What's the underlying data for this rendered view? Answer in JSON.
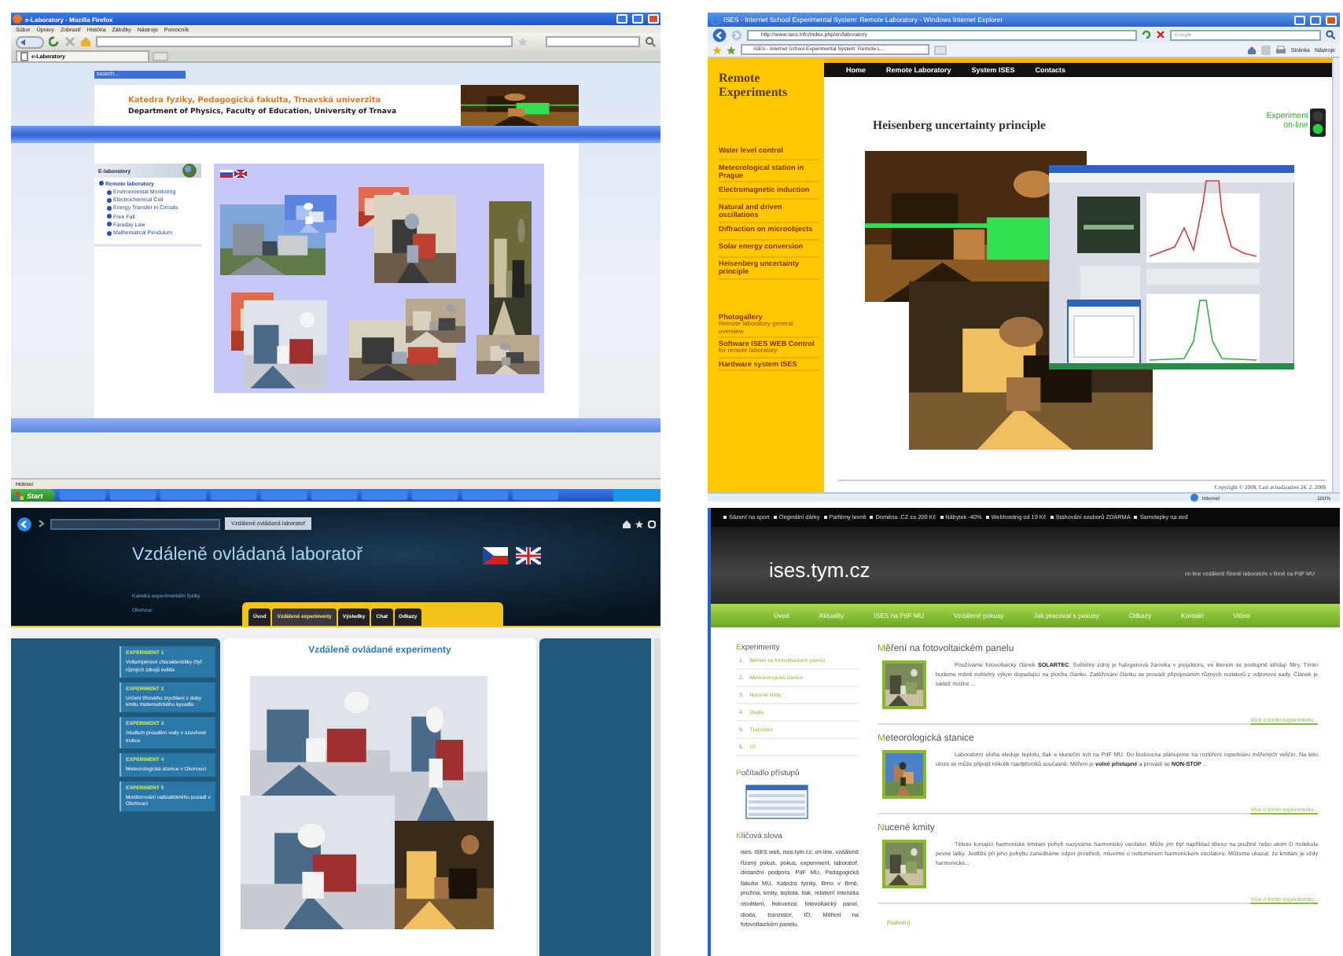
{
  "firefox_window": {
    "title": "e-Laboratory - Mozilla Firefox",
    "menu": [
      "Súbor",
      "Úpravy",
      "Zobraziť",
      "História",
      "Záložky",
      "Nástroje",
      "Pomocník"
    ],
    "tab": "e-Laboratory",
    "search": {
      "placeholder": "search..."
    },
    "header": {
      "title": "Katedra fyziky, Pedagogická fakulta, Trnavská univerzita",
      "subtitle": "Department of Physics, Faculty of Education, University of Trnava"
    },
    "sidebar": {
      "title": "E-laboratory",
      "items": [
        {
          "label": "Remote laboratory",
          "children": [
            {
              "label": "Environmental Monitoring"
            },
            {
              "label": "Electrochemical Cell"
            },
            {
              "label": "Energy Transfer in Circuits"
            },
            {
              "label": "Free Fall"
            },
            {
              "label": "Faraday Law"
            },
            {
              "label": "Mathematical Pendulum"
            }
          ]
        }
      ]
    },
    "status_bar": "Hotovo",
    "taskbar": {
      "start": "Start"
    }
  },
  "ie_window": {
    "title": "ISES - Internet School Experimental System: Remote Laboratory - Windows Internet Explorer",
    "address": "http://www.ises.info/index.php/en/laboratory",
    "tab": "ISES - Internet School Experimental System: Remote L...",
    "search": {
      "placeholder": "Google"
    },
    "toolbar": [
      "Stránka",
      "Nástroje"
    ],
    "nav": [
      "Home",
      "Remote Laboratory",
      "System ISES",
      "Contacts"
    ],
    "sidebar": {
      "title": "Remote Experiments",
      "experiments": [
        "Water level control",
        "Meteorological station in Prague",
        "Electromagnetic induction",
        "Natural and driven oscillations",
        "Diffraction on microobjects",
        "Solar energy conversion",
        "Heisenberg uncertainty principle"
      ],
      "links": [
        {
          "title": "Photogallery",
          "subtitle": "Remote laboratory general overview"
        },
        {
          "title": "Software ISES WEB Control",
          "subtitle": "for remote laboratory"
        },
        {
          "title": "Hardware system ISES"
        }
      ]
    },
    "heading": "Heisenberg uncertainty principle",
    "experiment_status": {
      "label": "Experiment on-line",
      "online": true
    },
    "copyright": "Copyright © 2008, Last actualization 24. 2. 2008",
    "status_bar": {
      "zone": "Internet",
      "zoom": "100%"
    }
  },
  "czech_window": {
    "tab": "Vzdálené ovládaná laboratoř",
    "title": "Vzdáleně ovládaná laboratoř",
    "links": [
      "Katedra experimentální fyziky",
      "Olomouc"
    ],
    "tabs": [
      {
        "label": "Úvod",
        "selected": false
      },
      {
        "label": "Vzdálené experimenty",
        "selected": true
      },
      {
        "label": "Výsledky",
        "selected": false
      },
      {
        "label": "Chat",
        "selected": false
      },
      {
        "label": "Odkazy",
        "selected": false
      }
    ],
    "heading": "Vzdáleně ovládané experimenty",
    "experiments": [
      {
        "number": "EXPERIMENT 1",
        "title": "Voltampérové charakteristiky čtyř různých zdrojů světla"
      },
      {
        "number": "EXPERIMENT 2",
        "title": "Určení tíhového zrychlení z doby kmitu matematického kyvadla"
      },
      {
        "number": "EXPERIMENT 3",
        "title": "Studium proudění vody v uzavřené trubce"
      },
      {
        "number": "EXPERIMENT 4",
        "title": "Meteorologická stanice v Olomouci"
      },
      {
        "number": "EXPERIMENT 5",
        "title": "Monitorování radioaktivního pozadí v Olomouci"
      }
    ]
  },
  "ises_window": {
    "top_links": [
      "Sázení na sport",
      "Originální dárky",
      "Parfémy levně",
      "Doména .CZ za 200 Kč",
      "Nábytek -40%",
      "Webhosting od 19 Kč",
      "Stahování souborů ZDARMA",
      "Samolepky na zeď"
    ],
    "logo": "ises.tym.cz",
    "tagline": "on-line vzdáleně řízené laboratoře v Brně na PdF MU",
    "nav": [
      "Úvod",
      "Aktuality",
      "ISES na PdF MU",
      "Vzdálené pokusy",
      "Jak pracovat s pokusy",
      "Odkazy",
      "Kontakt",
      "Video"
    ],
    "sidebar": {
      "experiments_title": "Experimenty",
      "experiments": [
        {
          "number": "1.",
          "label": "Měření na fotovoltaickém panelu"
        },
        {
          "number": "2.",
          "label": "Meteorologická stanice"
        },
        {
          "number": "3.",
          "label": "Nucené kmity"
        },
        {
          "number": "4.",
          "label": "Dioda"
        },
        {
          "number": "5.",
          "label": "Tranzistor"
        },
        {
          "number": "6.",
          "label": "IO"
        }
      ],
      "counter_title": "Počítadlo přístupů",
      "keywords_title": "Klíčová slova",
      "keywords": "ises, ISES web, ises.tym.cz, on-line, vzdáleně řízený pokus, pokus, experiment, laboratoř, distanční podpora, PdF MU, Pedagogická fakulta MU, Katedra fyziky, Brno v Brně, pružina, kmity, teplota, tlak, relativní intenzita osvětlení, frekvence, fotovoltaický panel, dioda, tranzistor, IO, Měření na fotovoltaickém panelu,"
    },
    "articles": [
      {
        "title": "Měření na fotovoltaickém panelu",
        "text": "Používáme fotovoltaický článek **SOLARTEC**. Světelný zdroj je halogenová žárovka v projektoru, ve kterém se postupně střídají filtry. Tímto budeme měnit světelný výkon dopadající na plochu článku. Zatěžování článku se provádí připojováním různých rezistorů z odporové sady. Článek je taktéž možné ...",
        "more": "Více o tomto experimentu..."
      },
      {
        "title": "Meteorologická stanice",
        "text": "Laboratorní úloha sleduje teplotu, tlak a sluneční svit na PdF MU. Do budoucna plánujeme na rozšíření repertoáru měřených veličin. Na této úloze se může připojit několik návštěvníků současně. Měření je **volně přístupné** a provádí se **NON-STOP** ...",
        "more": "Více o tomto experimentu..."
      },
      {
        "title": "Nucené kmity",
        "text": "Těleso konající harmonické kmitání pohyb nazýváme harmonický oscilátor. Může jím být například těleso na pružině nebo atom či molekula pevné látky. Jestliže při jeho pohybu zanedbáme odpor prostředí, mluvíme o netlumeném harmonickém oscilátoru. Můžeme ukázat, že kmitání je vždy harmonické...",
        "more": "Více o tomto experimentu..."
      }
    ],
    "top_link": "[Nahoru]"
  }
}
